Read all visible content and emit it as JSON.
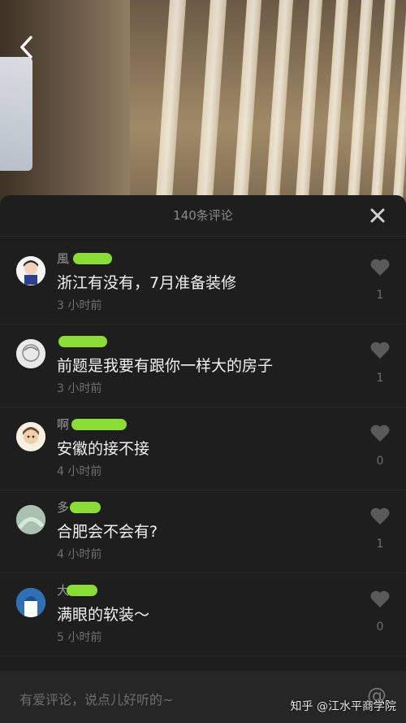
{
  "header": {
    "title": "140条评论"
  },
  "icons": {
    "back": "chevron-left-icon",
    "close": "close-icon",
    "like": "heart-icon",
    "mention": "at-icon"
  },
  "comments": [
    {
      "username": "風",
      "text": "浙江有没有，7月准备装修",
      "time": "3 小时前",
      "likes": "1"
    },
    {
      "username": "",
      "text": "前题是我要有跟你一样大的房子",
      "time": "3 小时前",
      "likes": "1"
    },
    {
      "username": "啊",
      "text": "安徽的接不接",
      "time": "4 小时前",
      "likes": "0"
    },
    {
      "username": "多",
      "text": "合肥会不会有?",
      "time": "4 小时前",
      "likes": "1"
    },
    {
      "username": "大",
      "text": "满眼的软装～",
      "time": "5 小时前",
      "likes": "0"
    }
  ],
  "input": {
    "placeholder": "有爱评论，说点儿好听的~",
    "mention_symbol": "@"
  },
  "watermark": "知乎 @江水平商学院",
  "colors": {
    "panel": "#1e1e1e",
    "text": "#f1f1f1",
    "muted": "#6f6f6f",
    "scribble": "#9dff3a"
  }
}
